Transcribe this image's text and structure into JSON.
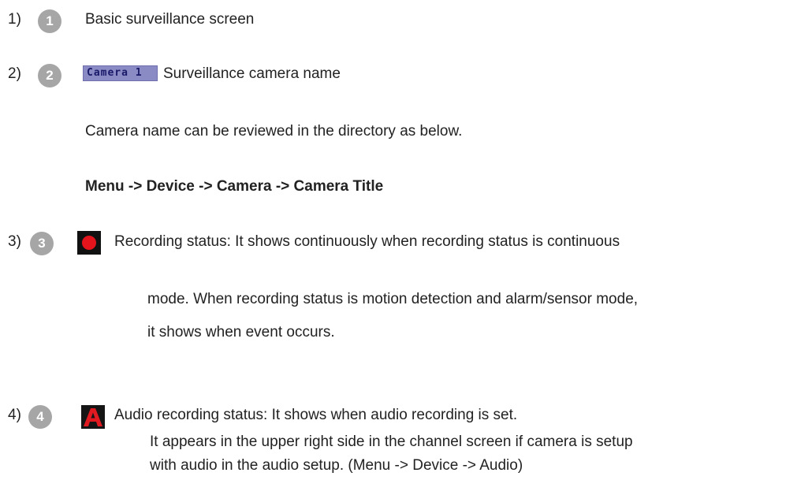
{
  "colors": {
    "badge_gray": "#a6a6a6",
    "record_red": "#e3141c",
    "audio_red": "#e11a22",
    "camera_tag_bg": "#8a8ac4"
  },
  "items": [
    {
      "num_label": "1)",
      "badge": "1",
      "description": "Basic surveillance screen"
    },
    {
      "num_label": "2)",
      "badge": "2",
      "icon": "camera-name-tag-icon",
      "icon_text": "Camera 1",
      "description": "Surveillance camera name",
      "note": "Camera name can be reviewed in the directory as below.",
      "path": "Menu -> Device -> Camera -> Camera Title"
    },
    {
      "num_label": "3)",
      "badge": "3",
      "icon": "recording-dot-icon",
      "lines": [
        "Recording status: It shows continuously when recording status is continuous",
        "mode. When recording status is motion detection and alarm/sensor mode,",
        "it shows when event occurs."
      ]
    },
    {
      "num_label": "4)",
      "badge": "4",
      "icon": "audio-a-icon",
      "lines": [
        "Audio recording status: It shows when audio recording is set.",
        "It appears in the upper right side in the channel screen if camera is setup",
        "with audio in the audio setup. (Menu -> Device -> Audio)"
      ]
    }
  ]
}
